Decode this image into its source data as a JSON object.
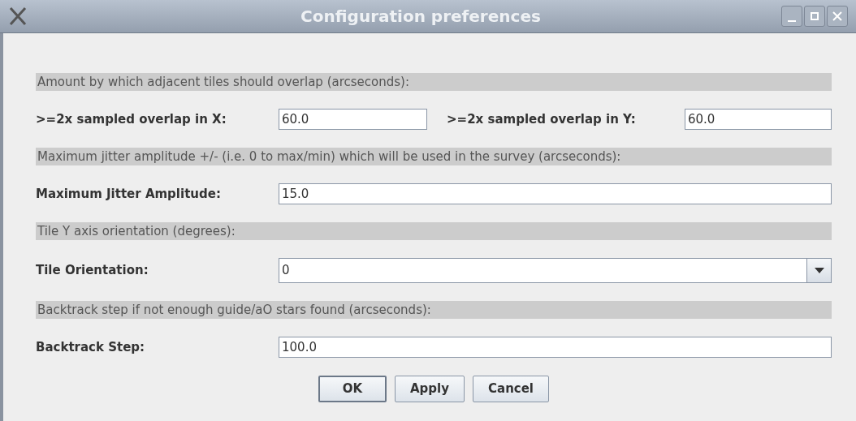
{
  "window": {
    "title": "Configuration preferences"
  },
  "sections": [
    {
      "heading": "Amount by which adjacent tiles should overlap (arcseconds):",
      "kind": "pair",
      "fields": [
        {
          "label": ">=2x sampled overlap in X:",
          "value": "60.0"
        },
        {
          "label": ">=2x sampled overlap in Y:",
          "value": "60.0"
        }
      ]
    },
    {
      "heading": "Maximum jitter amplitude +/- (i.e. 0 to max/min) which will be used in the survey (arcseconds):",
      "kind": "text",
      "fields": [
        {
          "label": "Maximum Jitter Amplitude:",
          "value": "15.0"
        }
      ]
    },
    {
      "heading": "Tile Y axis orientation (degrees):",
      "kind": "combo",
      "fields": [
        {
          "label": "Tile Orientation:",
          "value": "0"
        }
      ]
    },
    {
      "heading": "Backtrack step if not enough guide/aO stars found (arcseconds):",
      "kind": "text",
      "fields": [
        {
          "label": "Backtrack Step:",
          "value": "100.0"
        }
      ]
    }
  ],
  "buttons": [
    {
      "label": "OK",
      "default": true
    },
    {
      "label": "Apply",
      "default": false
    },
    {
      "label": "Cancel",
      "default": false
    }
  ]
}
